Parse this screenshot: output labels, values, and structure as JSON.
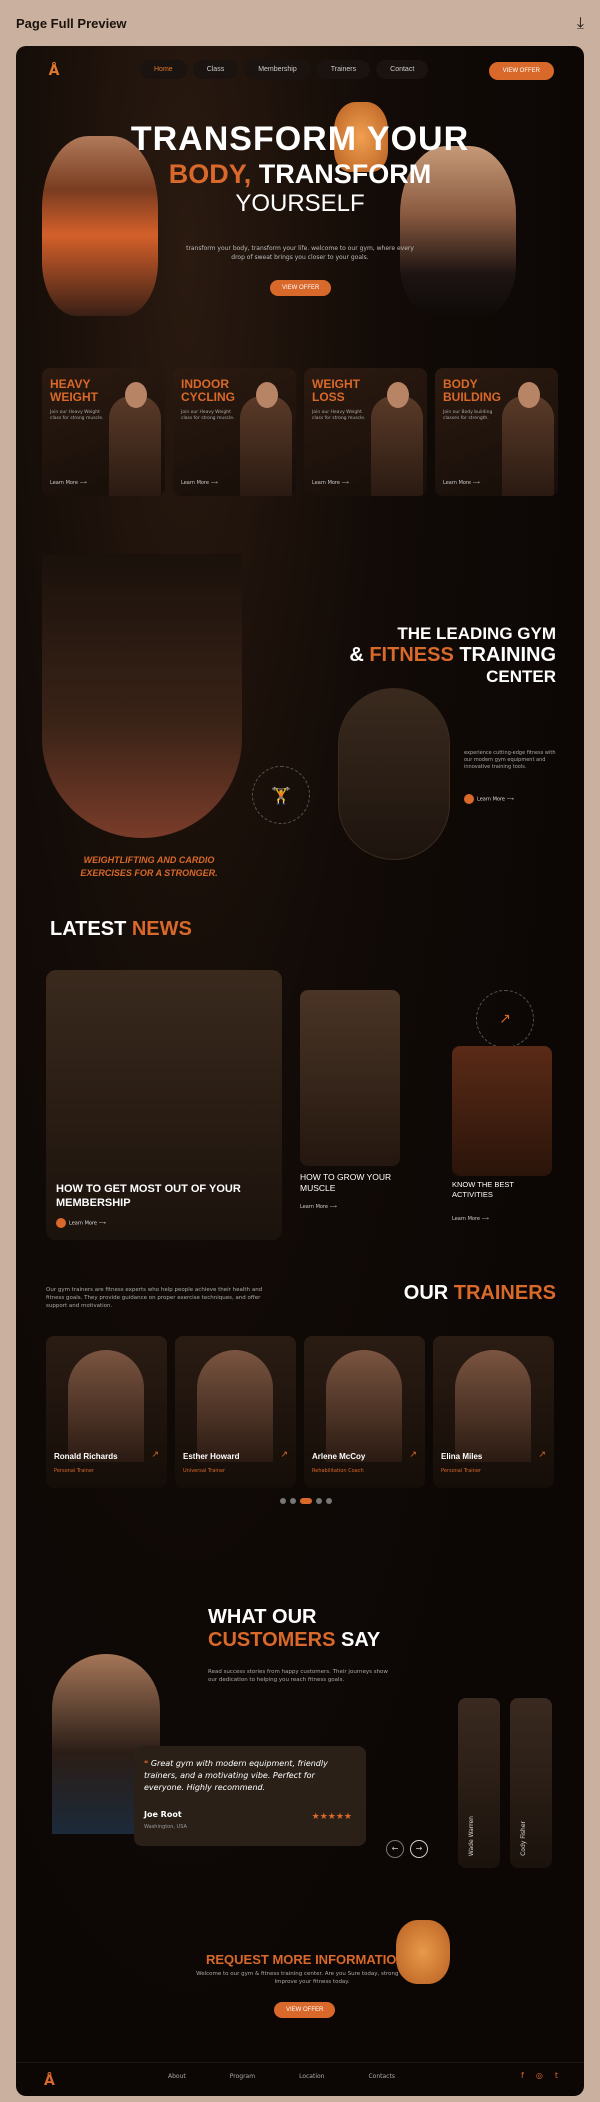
{
  "topbar": {
    "title": "Page Full Preview",
    "download_icon": "down-arrow-icon"
  },
  "nav": {
    "items": [
      "Home",
      "Class",
      "Membership",
      "Trainers",
      "Contact"
    ],
    "cta": "VIEW OFFER"
  },
  "hero": {
    "line1": "TRANSFORM YOUR",
    "line2_orange": "BODY,",
    "line2_white": " TRANSFORM",
    "line3": "YOURSELF",
    "sub": "transform your body, transform your life. welcome to our gym, where every drop of sweat brings you closer to your goals.",
    "cta": "VIEW OFFER"
  },
  "classes": [
    {
      "title": "HEAVY WEIGHT",
      "desc": "Join our Heavy Weight class for strong muscle.",
      "link": "Learn More"
    },
    {
      "title": "INDOOR CYCLING",
      "desc": "Join our Heavy Weight class for strong muscle.",
      "link": "Learn More"
    },
    {
      "title": "WEIGHT LOSS",
      "desc": "Join our Heavy Weight class for strong muscle.",
      "link": "Learn More"
    },
    {
      "title": "BODY BUILDING",
      "desc": "Join our Body building classes for strength.",
      "link": "Learn More"
    }
  ],
  "about": {
    "line1": "THE LEADING GYM",
    "line2_prefix": "& ",
    "line2_orange": "FITNESS",
    "line2_white": " TRAINING",
    "line3": "CENTER",
    "caption": "WEIGHTLIFTING AND CARDIO EXERCISES FOR A STRONGER.",
    "stamp": "FITNESS · FITNESS · FITNESS",
    "desc": "experience cutting-edge fitness with our modern gym equipment and innovative training tools.",
    "link": "Learn More"
  },
  "news": {
    "title_white": "LATEST ",
    "title_orange": "NEWS",
    "stamp": "FITNESS · FITNESS · FITNESS",
    "items": [
      {
        "title": "HOW TO GET MOST OUT OF YOUR MEMBERSHIP",
        "link": "Learn More"
      },
      {
        "title": "HOW TO GROW YOUR MUSCLE",
        "link": "Learn More"
      },
      {
        "title": "KNOW THE BEST ACTIVITIES",
        "link": "Learn More"
      }
    ]
  },
  "trainers": {
    "desc": "Our gym trainers are fitness experts who help people achieve their health and fitness goals. They provide guidance on proper exercise techniques, and offer support and motivation.",
    "title_white": "OUR ",
    "title_orange": "TRAINERS",
    "items": [
      {
        "name": "Ronald Richards",
        "role": "Personal Trainer"
      },
      {
        "name": "Esther Howard",
        "role": "Universal Trainer"
      },
      {
        "name": "Arlene McCoy",
        "role": "Rehabilitation Coach"
      },
      {
        "name": "Elina Miles",
        "role": "Personal Trainer"
      }
    ]
  },
  "testimonials": {
    "title_white": "WHAT OUR",
    "title_orange": "CUSTOMERS",
    "title_end": " SAY",
    "desc": "Read success stories from happy customers. Their journeys show our dedication to helping you reach fitness goals.",
    "quote": "Great gym with modern equipment, friendly trainers, and a motivating vibe. Perfect for everyone. Highly recommend.",
    "name": "Joe Root",
    "location": "Washington, USA",
    "stars": "★★★★★",
    "side_names": [
      "Wade Warren",
      "Cody Fisher"
    ]
  },
  "request": {
    "title": "REQUEST MORE INFORMATION",
    "desc": "Welcome to our gym & fitness training center. Are you Sure today, strong tomorrow. Improve your fitness today.",
    "cta": "VIEW OFFER"
  },
  "footer": {
    "links": [
      "About",
      "Program",
      "Location",
      "Contacts"
    ],
    "social": [
      "f",
      "◎",
      "t"
    ]
  },
  "colors": {
    "accent": "#d9692a",
    "bg": "#0f0906",
    "outer": "#c9b09f"
  }
}
